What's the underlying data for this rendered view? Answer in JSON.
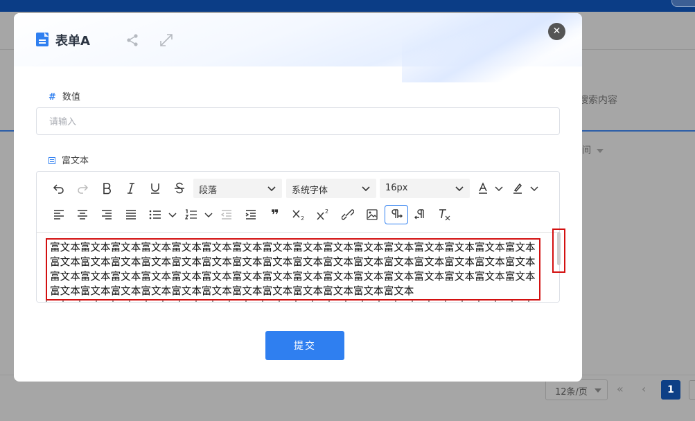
{
  "background": {
    "search_placeholder": "搜索内容",
    "column_header": "间",
    "page_size": "12条/页",
    "current_page": "1"
  },
  "modal": {
    "title": "表单A",
    "close_label": "✕",
    "fields": {
      "number": {
        "label": "数值",
        "placeholder": "请输入",
        "value": ""
      },
      "richtext": {
        "label": "富文本"
      }
    },
    "toolbar": {
      "paragraph": "段落",
      "font_family": "系统字体",
      "font_size": "16px"
    },
    "editor_content": "富文本富文本富文本富文本富文本富文本富文本富文本富文本富文本富文本富文本富文本富文本富文本富文本富文本富文本富文本富文本富文本富文本富文本富文本富文本富文本富文本富文本富文本富文本富文本富文本富文本富文本富文本富文本富文本富文本富文本富文本富文本富文本富文本富文本富文本富文本富文本富文本富文本富文本富文本富文本富文本富文本富文本富文本富文本富文本富文本富文本",
    "submit_label": "提交"
  },
  "colors": {
    "primary": "#2f7ff0",
    "highlight": "#d31010",
    "overlay": "#a6a6a6"
  }
}
